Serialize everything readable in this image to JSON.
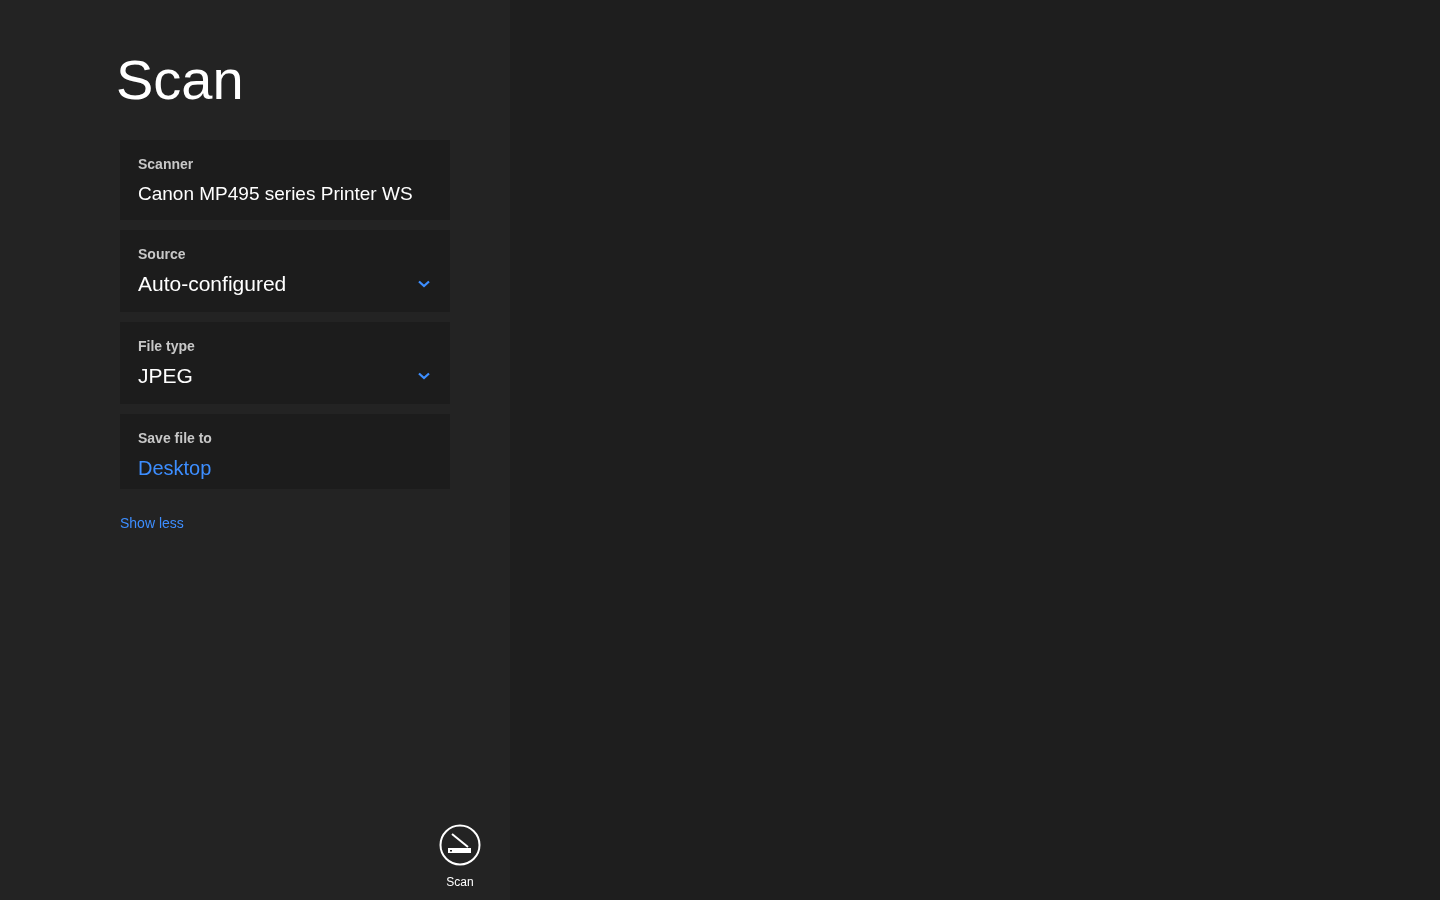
{
  "title": "Scan",
  "fields": [
    {
      "kind": "text",
      "label": "Scanner",
      "value": "Canon MP495 series Printer WS"
    },
    {
      "kind": "dropdown",
      "label": "Source",
      "value": "Auto-configured"
    },
    {
      "kind": "dropdown",
      "label": "File type",
      "value": "JPEG"
    },
    {
      "kind": "link",
      "label": "Save file to",
      "value": "Desktop"
    }
  ],
  "toggle_link": "Show less",
  "scan_button": {
    "label": "Scan"
  }
}
